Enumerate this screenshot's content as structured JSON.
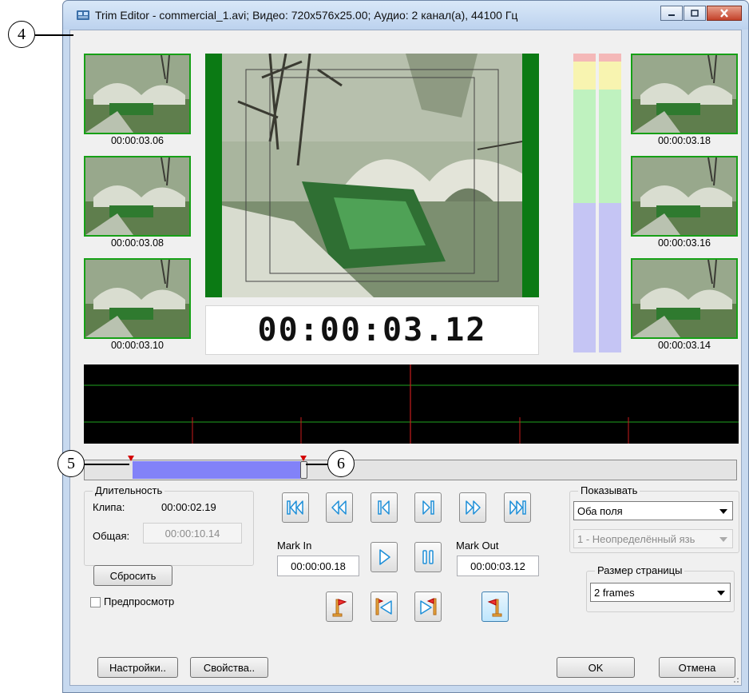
{
  "callouts": {
    "c4": "4",
    "c5": "5",
    "c6": "6"
  },
  "window": {
    "title": "Trim Editor - commercial_1.avi; Видео: 720x576x25.00; Аудио: 2 канал(а), 44100 Гц"
  },
  "thumbnails": {
    "left": [
      "00:00:03.06",
      "00:00:03.08",
      "00:00:03.10"
    ],
    "right": [
      "00:00:03.18",
      "00:00:03.16",
      "00:00:03.14"
    ]
  },
  "preview": {
    "timecode": "00:00:03.12"
  },
  "duration": {
    "title": "Длительность",
    "clip_label": "Клипа:",
    "clip_value": "00:00:02.19",
    "total_label": "Общая:",
    "total_value": "00:00:10.14"
  },
  "mark_in": {
    "label": "Mark In",
    "value": "00:00:00.18"
  },
  "mark_out": {
    "label": "Mark Out",
    "value": "00:00:03.12"
  },
  "show": {
    "title": "Показывать",
    "fields_value": "Оба поля",
    "language_value": "1 - Неопределённый язь"
  },
  "page_size": {
    "title": "Размер страницы",
    "value": "2 frames"
  },
  "buttons": {
    "reset": "Сбросить",
    "preview": "Предпросмотр",
    "settings": "Настройки..",
    "properties": "Свойства..",
    "ok": "OK",
    "cancel": "Отмена"
  },
  "icons": {
    "transport_row1": [
      "go-to-start-icon",
      "rewind-icon",
      "previous-frame-icon",
      "next-frame-icon",
      "fast-forward-icon",
      "go-to-end-icon"
    ],
    "play": "play-icon",
    "pause": "pause-icon",
    "set_mark_in": "flag-mark-in-icon",
    "go_mark_in": "go-to-mark-in-icon",
    "go_mark_out": "go-to-mark-out-icon",
    "set_mark_out": "flag-mark-out-icon"
  },
  "colors": {
    "selection": "#8282f8",
    "thumbnail_border": "#16a016",
    "marker": "#d40000",
    "icon_blue": "#1e8fd8"
  }
}
